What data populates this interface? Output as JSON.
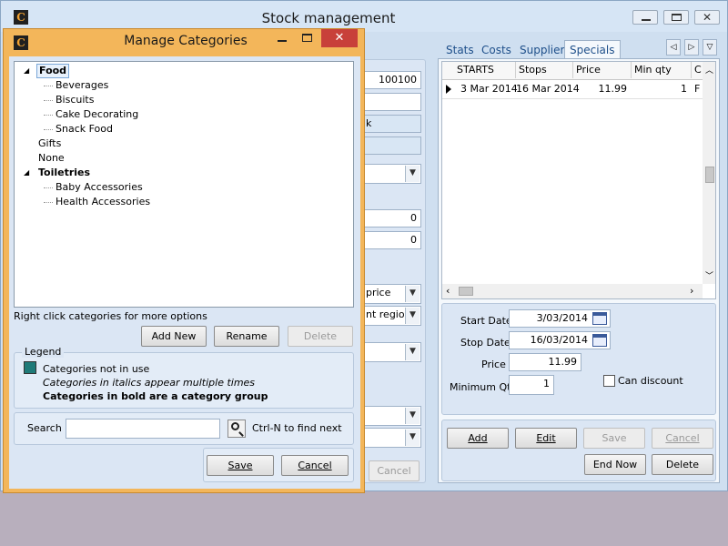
{
  "main_window": {
    "title": "Stock management",
    "icon": "app-logo-icon",
    "controls": [
      "minimize-icon",
      "maximize-icon",
      "close-icon"
    ]
  },
  "background_form": {
    "field_code": "100100",
    "field_k": "k",
    "field_num1": "0",
    "field_num2": "0",
    "dropdown_price": "price",
    "dropdown_region": "nt region",
    "cancel_label": "Cancel"
  },
  "tabs": {
    "items": [
      "Stats",
      "Costs",
      "Supplier",
      "Specials"
    ],
    "active": "Specials"
  },
  "specials_grid": {
    "columns": [
      "STARTS",
      "Stops",
      "Price",
      "Min qty",
      "C"
    ],
    "rows": [
      {
        "starts": "3 Mar 2014",
        "stops": "16 Mar 2014",
        "price": "11.99",
        "min_qty": "1",
        "c": "F"
      }
    ]
  },
  "special_form": {
    "start_date_label": "Start Date",
    "start_date_value": "3/03/2014",
    "stop_date_label": "Stop Date",
    "stop_date_value": "16/03/2014",
    "price_label": "Price",
    "price_value": "11.99",
    "min_qty_label": "Minimum Qty",
    "min_qty_value": "1",
    "can_discount_label": "Can discount",
    "can_discount_checked": false
  },
  "special_buttons": {
    "add": "Add",
    "edit": "Edit",
    "save": "Save",
    "cancel": "Cancel",
    "end_now": "End Now",
    "delete": "Delete"
  },
  "dialog": {
    "title": "Manage Categories",
    "tree": [
      {
        "label": "Food",
        "level": 0,
        "bold": true,
        "expanded": true,
        "selected": true
      },
      {
        "label": "Beverages",
        "level": 1
      },
      {
        "label": "Biscuits",
        "level": 1
      },
      {
        "label": "Cake Decorating",
        "level": 1
      },
      {
        "label": "Snack Food",
        "level": 1
      },
      {
        "label": "Gifts",
        "level": 0
      },
      {
        "label": "None",
        "level": 0
      },
      {
        "label": "Toiletries",
        "level": 0,
        "bold": true,
        "expanded": true
      },
      {
        "label": "Baby Accessories",
        "level": 1
      },
      {
        "label": "Health Accessories",
        "level": 1
      }
    ],
    "hint": "Right click categories for more options",
    "add_new": "Add New",
    "rename": "Rename",
    "delete": "Delete",
    "legend_title": "Legend",
    "legend_not_in_use": "Categories not in use",
    "legend_italics": "Categories in italics appear multiple times",
    "legend_bold": "Categories in bold are a category group",
    "legend_swatch_color": "#1f7a78",
    "search_label": "Search",
    "search_value": "",
    "search_hint": "Ctrl-N to find next",
    "save": "Save",
    "cancel": "Cancel"
  }
}
